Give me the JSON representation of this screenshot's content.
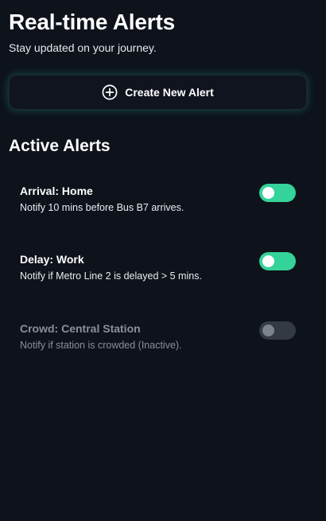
{
  "header": {
    "title": "Real-time Alerts",
    "subtitle": "Stay updated on your journey."
  },
  "create_button": {
    "icon": "plus-circle-icon",
    "label": "Create New Alert"
  },
  "active_alerts": {
    "title": "Active Alerts",
    "items": [
      {
        "name": "Arrival: Home",
        "description": "Notify 10 mins before Bus B7 arrives.",
        "enabled": true
      },
      {
        "name": "Delay: Work",
        "description": "Notify if Metro Line 2 is delayed > 5 mins.",
        "enabled": true
      },
      {
        "name": "Crowd: Central Station",
        "description": "Notify if station is crowded (Inactive).",
        "enabled": false
      }
    ]
  },
  "colors": {
    "background": "#0d121b",
    "accent": "#34d399",
    "toggle_off": "#343a44",
    "muted_text": "#8a909a"
  }
}
